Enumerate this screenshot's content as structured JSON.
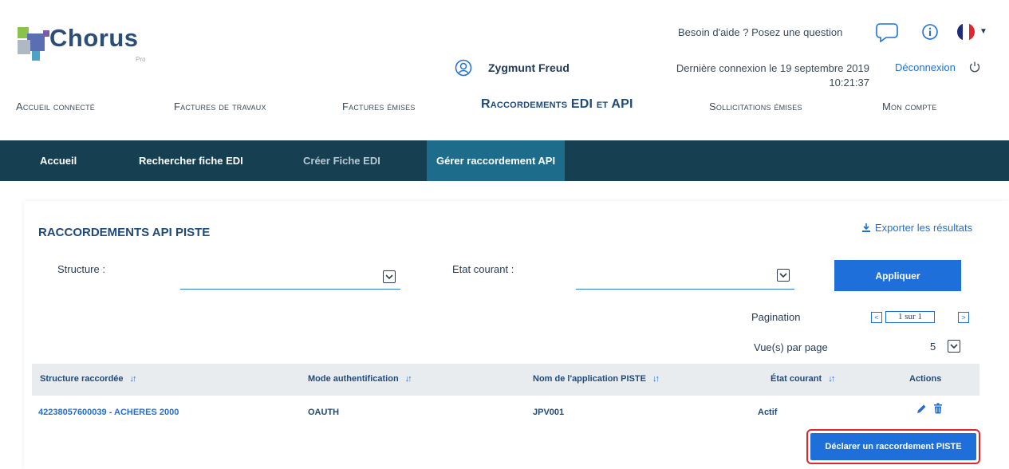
{
  "brand": {
    "logo_text": "Chorus",
    "logo_sub": "Pro",
    "colors": {
      "dark_blue": "#173f52",
      "active_tab": "#1e6c8c",
      "primary": "#1e6fd9",
      "highlight": "#e0262e"
    }
  },
  "header": {
    "help_text": "Besoin d'aide ? Posez une question",
    "user_name": "Zygmunt Freud",
    "last_login_line1": "Dernière connexion le 19 septembre 2019",
    "last_login_line2": "10:21:37",
    "logout_label": "Déconnexion",
    "icons": [
      "chat-icon",
      "info-icon",
      "flag-fr-icon",
      "user-icon",
      "power-icon"
    ]
  },
  "main_nav": {
    "items": [
      {
        "label": "Accueil connecté"
      },
      {
        "label": "Factures de travaux"
      },
      {
        "label": "Factures émises"
      },
      {
        "label": "Raccordements EDI et API"
      },
      {
        "label": "Sollicitations émises"
      },
      {
        "label": "Mon compte"
      }
    ]
  },
  "sub_nav": {
    "items": [
      {
        "label": "Accueil"
      },
      {
        "label": "Rechercher fiche EDI"
      },
      {
        "label": "Créer Fiche EDI"
      },
      {
        "label": "Gérer raccordement API"
      }
    ]
  },
  "panel": {
    "title": "RACCORDEMENTS API PISTE",
    "export_label": "Exporter les résultats",
    "filters": {
      "structure_label": "Structure :",
      "structure_value": "",
      "state_label": "Etat courant :",
      "state_value": ""
    },
    "apply_label": "Appliquer",
    "pagination": {
      "label": "Pagination",
      "prev": "<",
      "value": "1 sur 1",
      "next": ">"
    },
    "per_page": {
      "label": "Vue(s) par page",
      "value": "5"
    },
    "table": {
      "headers": [
        "Structure raccordée",
        "Mode authentification",
        "Nom de l'application PISTE",
        "État courant",
        "Actions"
      ],
      "sort_glyph": "↓↑",
      "rows": [
        {
          "structure": "42238057600039 - ACHERES 2000",
          "mode": "OAUTH",
          "app": "JPV001",
          "state": "Actif"
        }
      ]
    },
    "declare_label": "Déclarer un raccordement PISTE"
  }
}
